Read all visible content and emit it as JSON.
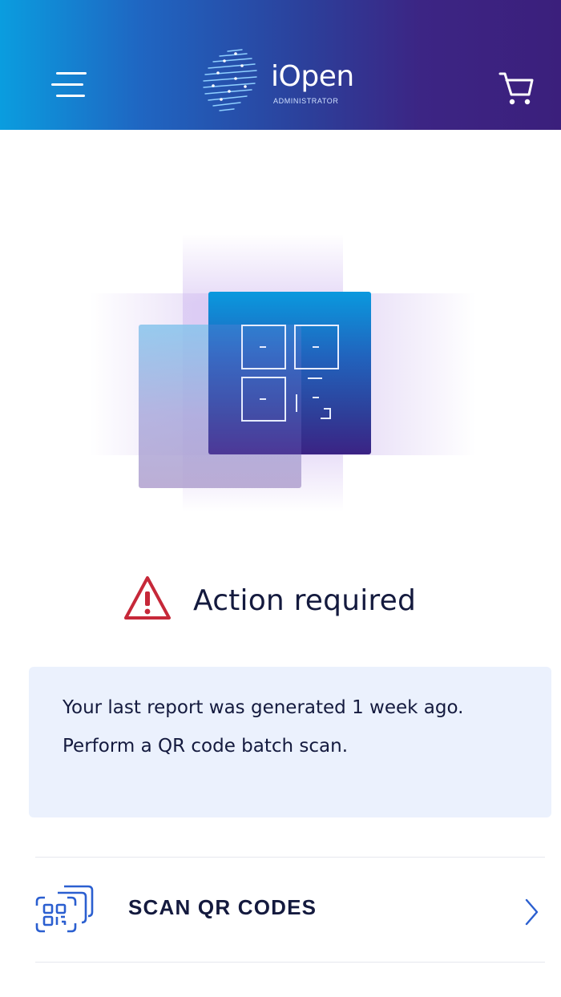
{
  "header": {
    "logo_name": "iOpen",
    "logo_subtitle": "ADMINISTRATOR",
    "menu_icon": "hamburger-menu-icon",
    "cart_icon": "shopping-cart-icon",
    "gradient_start": "#0a9ddf",
    "gradient_end": "#3b1f7c"
  },
  "hero": {
    "illustration": "qr-scan-illustration"
  },
  "alert": {
    "icon": "warning-triangle-icon",
    "icon_color": "#c62839",
    "title": "Action required"
  },
  "info": {
    "line1": "Your last report was generated 1 week ago.",
    "line2": "Perform a QR code batch scan.",
    "background": "#ebf1fd"
  },
  "scan": {
    "icon": "qr-batch-icon",
    "label": "SCAN QR CODES",
    "chevron_icon": "chevron-right-icon",
    "accent": "#2b5fd0"
  }
}
